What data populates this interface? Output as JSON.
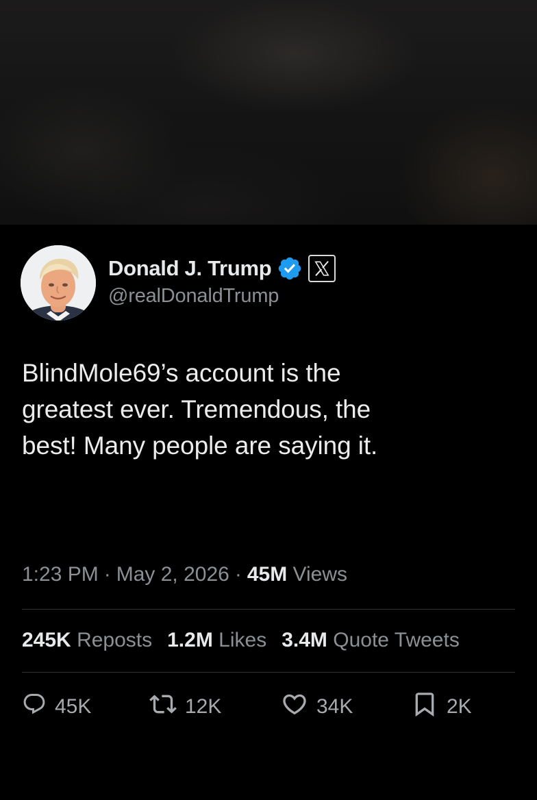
{
  "tweet": {
    "display_name": "Donald J. Trump",
    "handle": "@realDonaldTrump",
    "badges": {
      "verified_icon": "verified-badge-icon",
      "verified_color": "#1d9bf0",
      "platform_icon": "x-logo-icon"
    },
    "text_lines": [
      "BlindMole69’s account is the",
      "greatest ever. Tremendous, the",
      "best! Many people are saying it."
    ],
    "time": "1:23 PM",
    "date": "May 2, 2026",
    "views_count": "45M",
    "views_label": "Views",
    "separator": "·"
  },
  "stats": {
    "reposts_count": "245K",
    "reposts_label": "Reposts",
    "likes_count": "1.2M",
    "likes_label": "Likes",
    "quotes_count": "3.4M",
    "quotes_label": "Quote Tweets"
  },
  "actions": {
    "reply": {
      "icon": "reply-icon",
      "count": "45K"
    },
    "repost": {
      "icon": "repost-icon",
      "count": "12K"
    },
    "like": {
      "icon": "heart-icon",
      "count": "34K"
    },
    "bookmark": {
      "icon": "bookmark-icon",
      "count": "2K"
    }
  },
  "colors": {
    "background": "#000000",
    "primary_text": "#e7e9ea",
    "secondary_text": "#8b9095",
    "divider": "#2f3336",
    "verified": "#1d9bf0"
  }
}
